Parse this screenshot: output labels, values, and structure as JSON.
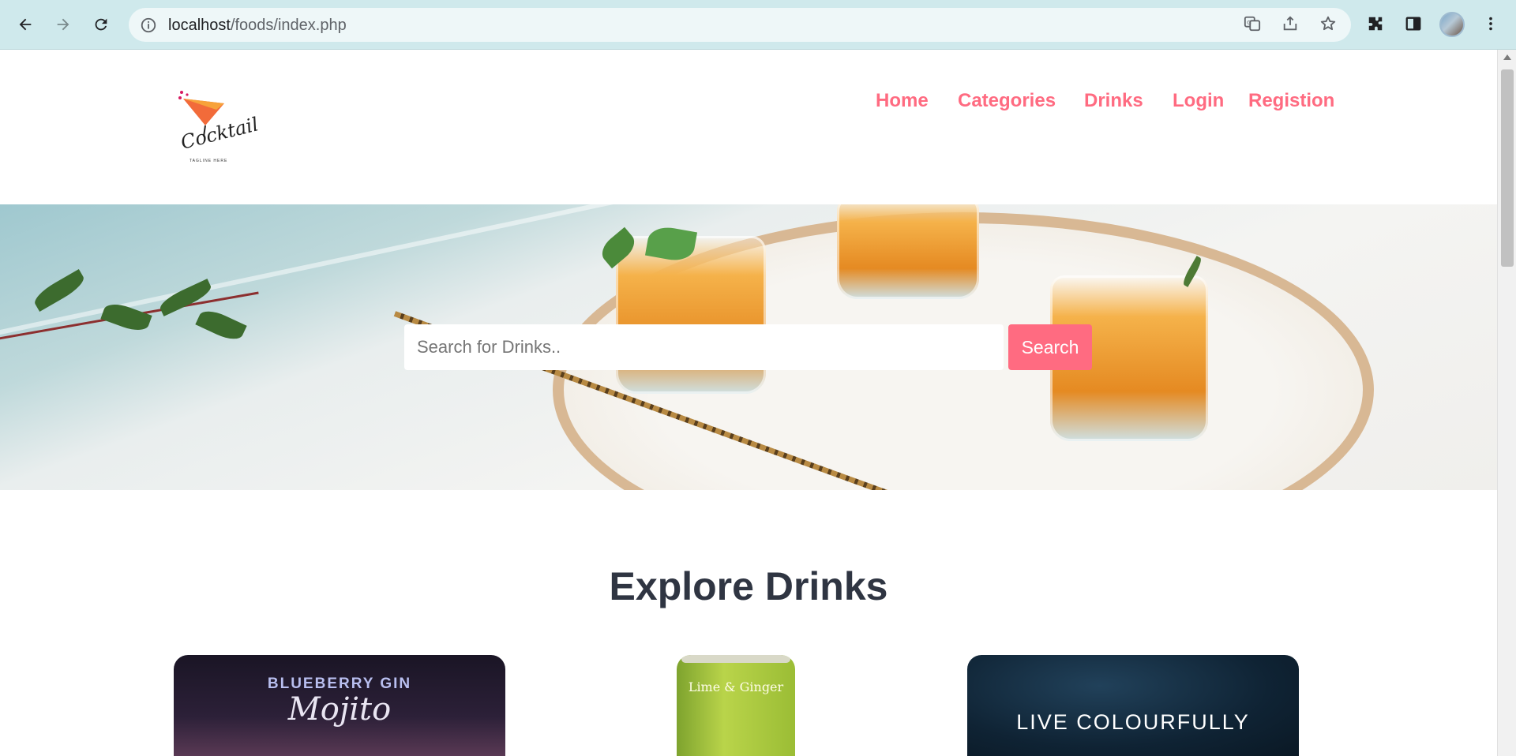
{
  "browser": {
    "url_host": "localhost",
    "url_path": "/foods/index.php"
  },
  "logo": {
    "script_text": "Cocktail",
    "tagline": "TAGLINE HERE"
  },
  "nav": {
    "items": [
      {
        "label": "Home"
      },
      {
        "label": "Categories"
      },
      {
        "label": "Drinks"
      },
      {
        "label": "Login"
      },
      {
        "label": "Registion"
      }
    ]
  },
  "search": {
    "placeholder": "Search for Drinks..",
    "value": "",
    "button_label": "Search"
  },
  "explore": {
    "title": "Explore Drinks",
    "cards": [
      {
        "heading": "BLUEBERRY GIN",
        "sub": "Mojito"
      },
      {
        "heading": "Lime & Ginger"
      },
      {
        "heading": "LIVE COLOURFULLY"
      }
    ]
  },
  "colors": {
    "accent": "#ff6b81",
    "title": "#2f3542",
    "browser_bar": "#cfe9ec"
  }
}
